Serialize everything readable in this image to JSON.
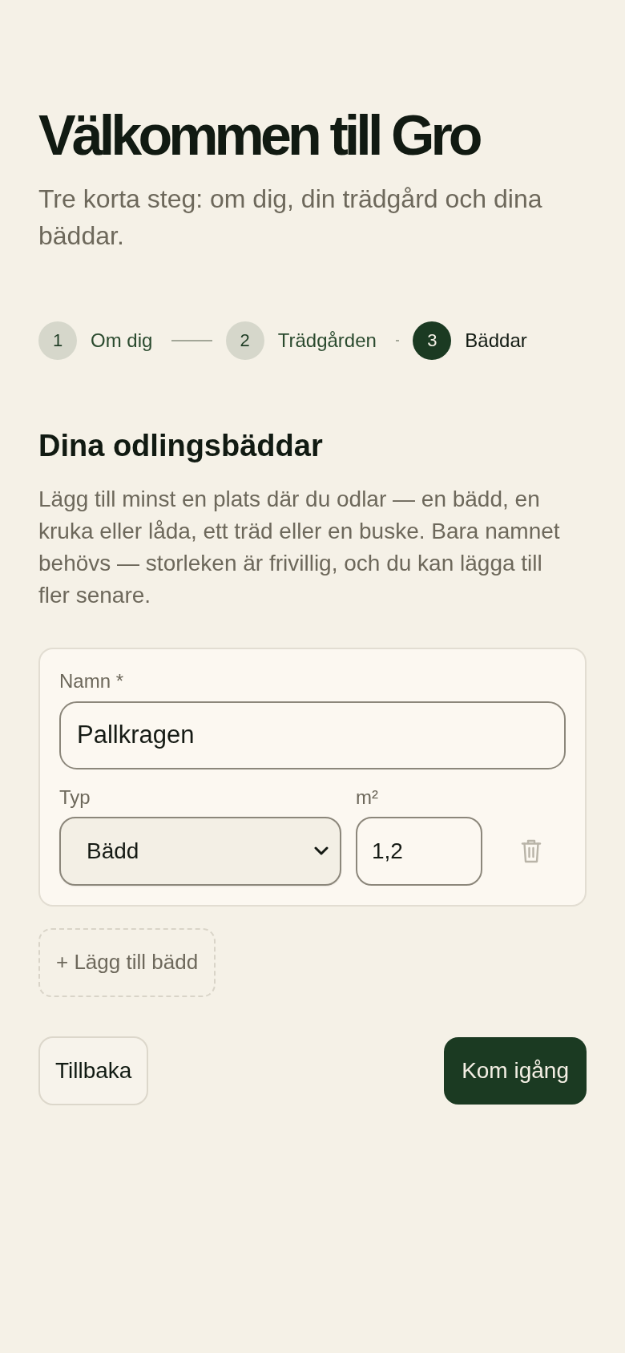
{
  "header": {
    "title": "Välkommen till Gro",
    "subtitle": "Tre korta steg: om dig, din trädgård och dina bäddar."
  },
  "steps": [
    {
      "number": "1",
      "label": "Om dig",
      "selected": false
    },
    {
      "number": "2",
      "label": "Trädgården",
      "selected": false
    },
    {
      "number": "3",
      "label": "Bäddar",
      "selected": true
    }
  ],
  "section": {
    "title": "Dina odlingsbäddar",
    "description": "Lägg till minst en plats där du odlar — en bädd, en kruka eller låda, ett träd eller en buske. Bara namnet behövs — storleken är frivillig, och du kan lägga till fler senare."
  },
  "beds": [
    {
      "name_label": "Namn *",
      "name_value": "Pallkragen",
      "type_label": "Typ",
      "type_value": "Bädd",
      "size_label": "m²",
      "size_value": "1,2"
    }
  ],
  "add_button": "+ Lägg till bädd",
  "buttons": {
    "back": "Tillbaka",
    "primary": "Kom igång"
  }
}
